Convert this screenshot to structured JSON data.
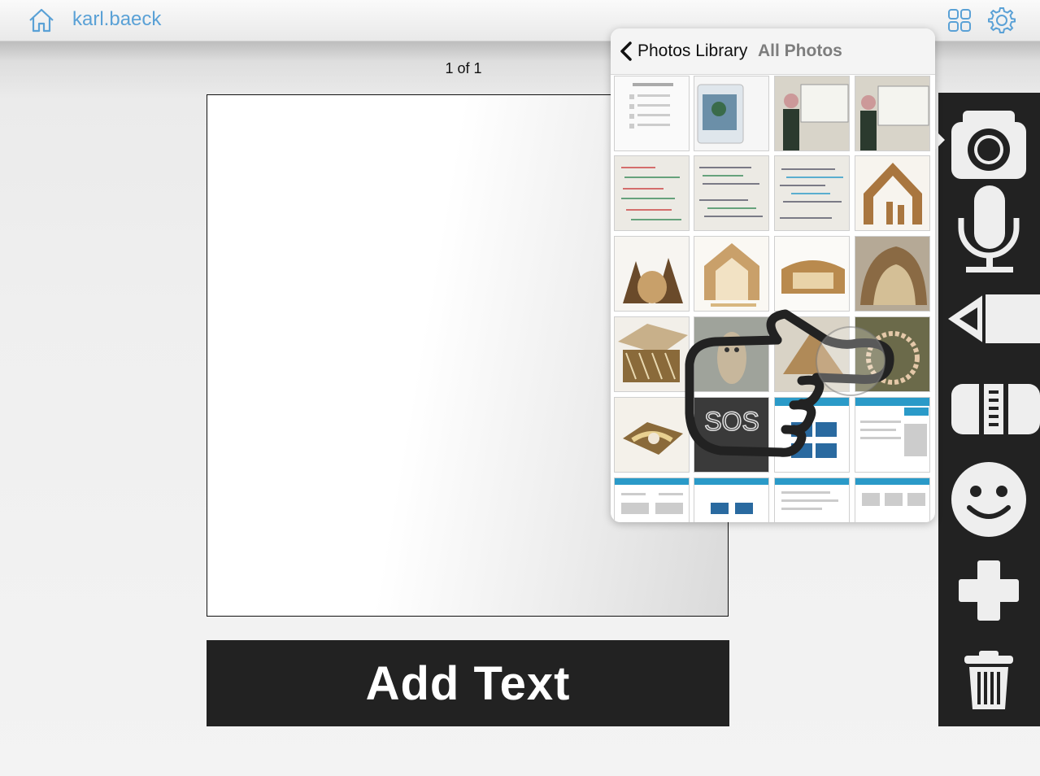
{
  "header": {
    "home_icon": "home-icon",
    "username": "karl.baeck",
    "layout_icon": "grid-icon",
    "settings_icon": "gear-icon",
    "accent_color": "#5aa1d6"
  },
  "page": {
    "counter": "1 of 1"
  },
  "caption_bar": {
    "label": "Add Text"
  },
  "toolbar": {
    "items": [
      "camera-icon",
      "microphone-icon",
      "pencil-icon",
      "eraser-icon",
      "smiley-icon",
      "plus-icon",
      "trash-icon"
    ]
  },
  "photos_popover": {
    "back_label": "Photos Library",
    "title": "All Photos",
    "thumbnails": [
      "notes-document",
      "tablet-screenshot",
      "man-at-whiteboard",
      "man-at-whiteboard-2",
      "whiteboard-notes",
      "whiteboard-notes-2",
      "whiteboard-notes-3",
      "wooden-nativity",
      "wooden-nativity-trees",
      "wooden-nativity-2",
      "wooden-nativity-3",
      "wooden-nativity-cave",
      "wooden-manger",
      "wooden-figure",
      "wooden-stable",
      "rosary-beads",
      "manger-straw",
      "sos-chalkboard",
      "app-screenshot",
      "app-screenshot-2",
      "dashboard-screenshot",
      "dashboard-screenshot-2",
      "dashboard-screenshot-3",
      "dashboard-screenshot-4"
    ],
    "sos_text": "SOS"
  },
  "overlay": {
    "pointer_icon": "hand-pointer-icon"
  }
}
